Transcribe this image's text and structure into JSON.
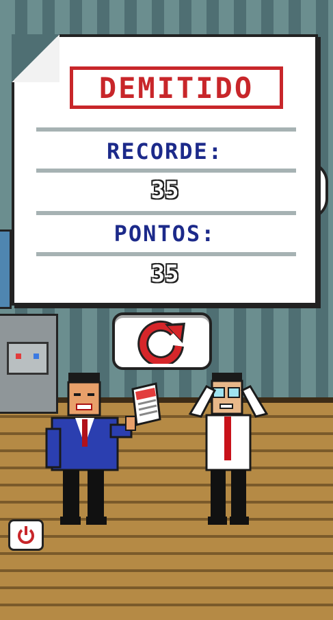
{
  "result": {
    "title": "DEMITIDO",
    "record_label": "RECORDE:",
    "record_value": "35",
    "points_label": "PONTOS:",
    "points_value": "35"
  },
  "controls": {
    "restart_icon": "restart-arrow-icon",
    "power_icon": "power-icon"
  },
  "colors": {
    "title_red": "#c8262a",
    "label_blue": "#1c2a8a",
    "wall_light": "#6b8e8f",
    "wall_dark": "#4f6f73",
    "floor": "#b58a45"
  }
}
